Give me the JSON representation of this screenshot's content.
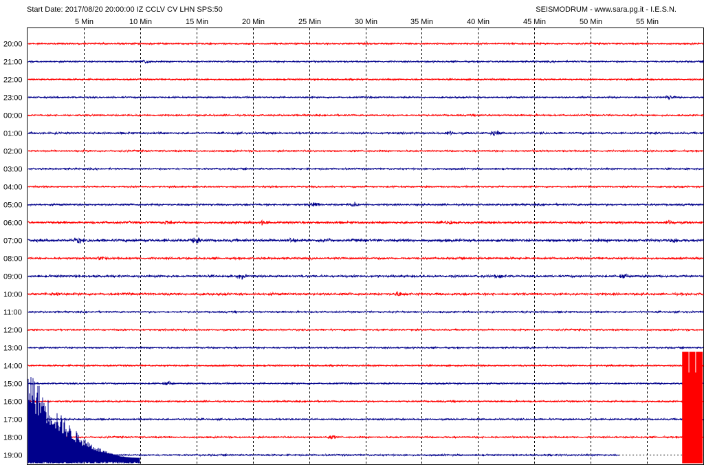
{
  "header": {
    "start_info": "Start Date: 2017/08/20 20:00:00 IZ CCLV CV LHN SPS:50",
    "credits": "SEISMODRUM - www.sara.pg.it - I.E.S.N."
  },
  "colors": {
    "trace_red": "#ff0000",
    "trace_blue": "#00008b",
    "grid": "#000000",
    "background": "#ffffff"
  },
  "chart_data": {
    "type": "line",
    "title": "",
    "x_unit": "Min",
    "x_ticks": [
      "5 Min",
      "10 Min",
      "15 Min",
      "20 Min",
      "25 Min",
      "30 Min",
      "35 Min",
      "40 Min",
      "45 Min",
      "50 Min",
      "55 Min"
    ],
    "xlim": [
      0,
      60
    ],
    "grid": true,
    "rows": [
      {
        "hour": "20:00",
        "color": "red",
        "amplitude": 1.0,
        "bursts": []
      },
      {
        "hour": "21:00",
        "color": "blue",
        "amplitude": 1.0,
        "bursts": [
          10.5
        ]
      },
      {
        "hour": "22:00",
        "color": "red",
        "amplitude": 1.0,
        "bursts": []
      },
      {
        "hour": "23:00",
        "color": "blue",
        "amplitude": 1.0,
        "bursts": [
          57
        ]
      },
      {
        "hour": "00:00",
        "color": "red",
        "amplitude": 1.0,
        "bursts": []
      },
      {
        "hour": "01:00",
        "color": "blue",
        "amplitude": 1.2,
        "bursts": [
          37.5,
          41.5
        ]
      },
      {
        "hour": "02:00",
        "color": "red",
        "amplitude": 1.0,
        "bursts": []
      },
      {
        "hour": "03:00",
        "color": "blue",
        "amplitude": 1.0,
        "bursts": []
      },
      {
        "hour": "04:00",
        "color": "red",
        "amplitude": 1.0,
        "bursts": []
      },
      {
        "hour": "05:00",
        "color": "blue",
        "amplitude": 1.2,
        "bursts": [
          25.5,
          29
        ]
      },
      {
        "hour": "06:00",
        "color": "red",
        "amplitude": 1.5,
        "bursts": [
          12.5,
          21,
          37.5,
          57
        ]
      },
      {
        "hour": "07:00",
        "color": "blue",
        "amplitude": 1.8,
        "bursts": [
          4.5,
          15,
          23.5,
          26.5,
          57.5
        ]
      },
      {
        "hour": "08:00",
        "color": "red",
        "amplitude": 1.3,
        "bursts": [
          6.5
        ]
      },
      {
        "hour": "09:00",
        "color": "blue",
        "amplitude": 1.4,
        "bursts": [
          19,
          42,
          53
        ]
      },
      {
        "hour": "10:00",
        "color": "red",
        "amplitude": 1.5,
        "bursts": [
          2.5,
          33
        ]
      },
      {
        "hour": "11:00",
        "color": "blue",
        "amplitude": 1.0,
        "bursts": []
      },
      {
        "hour": "12:00",
        "color": "red",
        "amplitude": 1.0,
        "bursts": []
      },
      {
        "hour": "13:00",
        "color": "blue",
        "amplitude": 1.0,
        "bursts": []
      },
      {
        "hour": "14:00",
        "color": "red",
        "amplitude": 1.0,
        "bursts": []
      },
      {
        "hour": "15:00",
        "color": "blue",
        "amplitude": 1.0,
        "bursts": [
          12.5
        ]
      },
      {
        "hour": "16:00",
        "color": "red",
        "amplitude": 1.0,
        "bursts": []
      },
      {
        "hour": "17:00",
        "color": "blue",
        "amplitude": 1.0,
        "bursts": []
      },
      {
        "hour": "18:00",
        "color": "red",
        "amplitude": 1.0,
        "bursts": [
          27
        ]
      },
      {
        "hour": "19:00",
        "color": "blue",
        "amplitude": 1.0,
        "bursts": [],
        "end_minute": 52.5
      }
    ],
    "events": [
      {
        "name": "large-event-onset",
        "color": "blue",
        "start_minute": 0,
        "end_minute": 10,
        "from_hour": "15:00",
        "to_hour": "19:00"
      },
      {
        "name": "saturated-block",
        "color": "red",
        "start_minute": 58,
        "end_minute": 60,
        "from_hour": "14:00",
        "to_hour": "19:00"
      }
    ]
  }
}
